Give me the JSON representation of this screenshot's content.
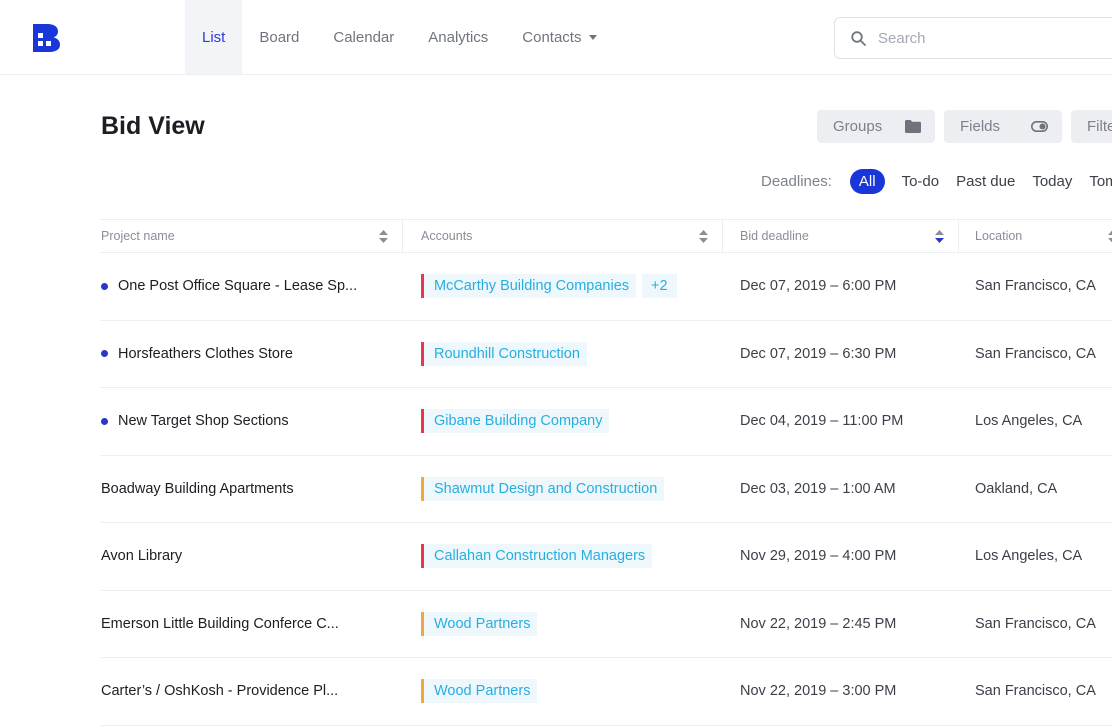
{
  "nav": {
    "tabs": [
      {
        "label": "List",
        "active": true
      },
      {
        "label": "Board"
      },
      {
        "label": "Calendar"
      },
      {
        "label": "Analytics"
      },
      {
        "label": "Contacts",
        "has_dropdown": true
      }
    ]
  },
  "search": {
    "placeholder": "Search"
  },
  "page": {
    "title": "Bid View"
  },
  "toolbar": {
    "groups_label": "Groups",
    "fields_label": "Fields",
    "filter_label": "Filters"
  },
  "deadlines": {
    "label": "Deadlines:",
    "filters": [
      "All",
      "To-do",
      "Past due",
      "Today",
      "Tomorrow"
    ],
    "selected": "All"
  },
  "table": {
    "columns": [
      "Project name",
      "Accounts",
      "Bid deadline",
      "Location"
    ],
    "rows": [
      {
        "project": "One Post Office Square - Lease Sp...",
        "flagged": true,
        "account": "McCarthy Building Companies",
        "account_color": "#e8374d",
        "extra": "+2",
        "deadline": "Dec 07, 2019 – 6:00 PM",
        "location": "San Francisco, CA"
      },
      {
        "project": "Horsfeathers Clothes Store",
        "flagged": true,
        "account": "Roundhill Construction",
        "account_color": "#e8374d",
        "deadline": "Dec 07, 2019 – 6:30 PM",
        "location": "San Francisco, CA"
      },
      {
        "project": "New Target Shop Sections",
        "flagged": true,
        "account": "Gibane Building Company",
        "account_color": "#e8374d",
        "deadline": "Dec 04, 2019 – 11:00 PM",
        "location": "Los Angeles, CA"
      },
      {
        "project": "Boadway Building Apartments",
        "flagged": false,
        "account": "Shawmut Design and Construction",
        "account_color": "#f3a73b",
        "deadline": "Dec 03, 2019 – 1:00 AM",
        "location": "Oakland, CA"
      },
      {
        "project": "Avon Library",
        "flagged": false,
        "account": "Callahan Construction Managers",
        "account_color": "#e8374d",
        "deadline": "Nov 29, 2019 – 4:00 PM",
        "location": "Los Angeles, CA"
      },
      {
        "project": "Emerson Little Building Conferce C...",
        "flagged": false,
        "account": "Wood Partners",
        "account_color": "#f3a73b",
        "deadline": "Nov 22, 2019 – 2:45 PM",
        "location": "San Francisco, CA"
      },
      {
        "project": "Carter’s / OshKosh - Providence Pl...",
        "flagged": false,
        "account": "Wood Partners",
        "account_color": "#f3a73b",
        "deadline": "Nov 22, 2019 – 3:00 PM",
        "location": "San Francisco, CA"
      }
    ]
  },
  "colors": {
    "brand": "#1936d9",
    "active_tab_text": "#2a3bd6",
    "account_link": "#27aee0",
    "urgent_bar": "#e8374d",
    "warning_bar": "#f3a73b"
  },
  "icons": [
    "logo-icon",
    "search-icon",
    "folder-icon",
    "toggle-icon",
    "sort-icon",
    "caret-down-icon"
  ]
}
